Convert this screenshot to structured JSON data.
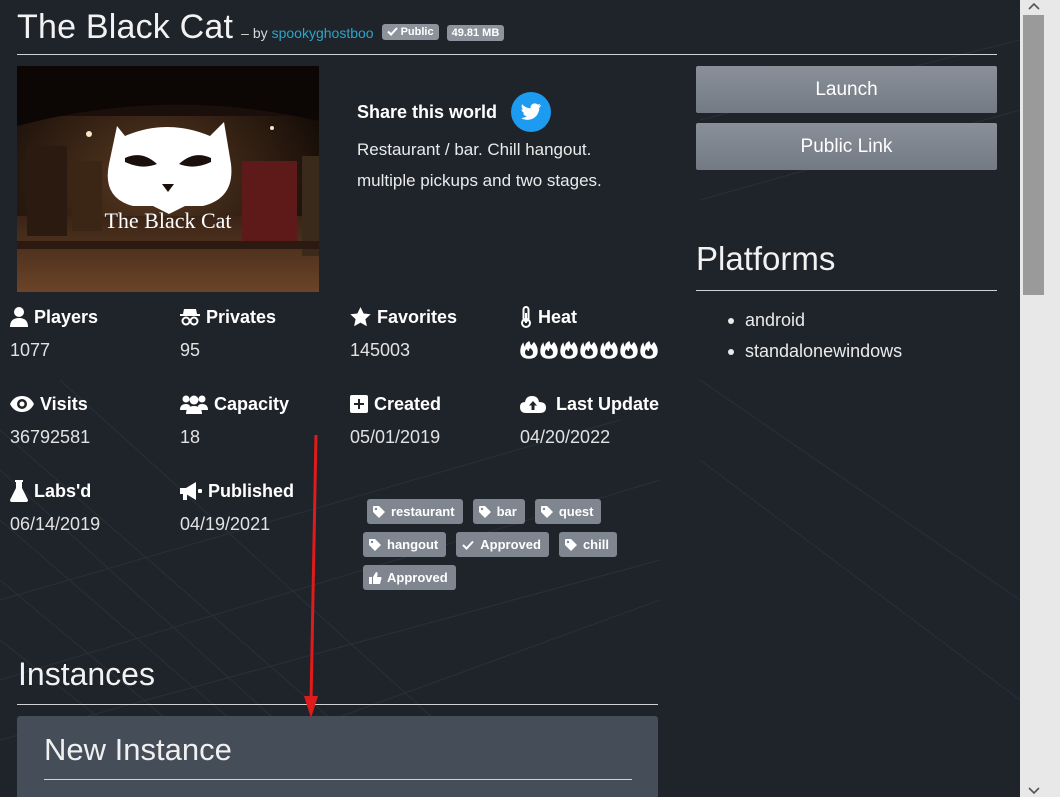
{
  "header": {
    "title": "The Black Cat",
    "by_label": "– by",
    "author": "spookyghostboo",
    "visibility_badge": "Public",
    "size_badge": "49.81 MB"
  },
  "world_image": {
    "overlay_text": "The Black Cat"
  },
  "share": {
    "label": "Share this world",
    "icon": "twitter-icon"
  },
  "description": {
    "line1": "Restaurant / bar. Chill hangout.",
    "line2": "multiple pickups and two stages."
  },
  "actions": {
    "launch": "Launch",
    "public_link": "Public Link"
  },
  "platforms": {
    "title": "Platforms",
    "items": [
      "android",
      "standalonewindows"
    ]
  },
  "stats": {
    "players": {
      "label": "Players",
      "value": "1077",
      "icon": "user-icon"
    },
    "privates": {
      "label": "Privates",
      "value": "95",
      "icon": "incognito-icon"
    },
    "favorites": {
      "label": "Favorites",
      "value": "145003",
      "icon": "star-icon"
    },
    "heat": {
      "label": "Heat",
      "level": 7,
      "max": 7,
      "icon": "thermometer-icon"
    },
    "visits": {
      "label": "Visits",
      "value": "36792581",
      "icon": "eye-icon"
    },
    "capacity": {
      "label": "Capacity",
      "value": "18",
      "icon": "users-icon"
    },
    "created": {
      "label": "Created",
      "value": "05/01/2019",
      "icon": "plus-square-icon"
    },
    "last_update": {
      "label": "Last Update",
      "value": "04/20/2022",
      "icon": "cloud-upload-icon"
    },
    "labs": {
      "label": "Labs'd",
      "value": "06/14/2019",
      "icon": "flask-icon"
    },
    "published": {
      "label": "Published",
      "value": "04/19/2021",
      "icon": "megaphone-icon"
    }
  },
  "tags": [
    {
      "label": "restaurant",
      "icon": "tag-icon"
    },
    {
      "label": "bar",
      "icon": "tag-icon"
    },
    {
      "label": "quest",
      "icon": "tag-icon"
    },
    {
      "label": "hangout",
      "icon": "tag-icon"
    },
    {
      "label": "Approved",
      "icon": "check-icon"
    },
    {
      "label": "chill",
      "icon": "tag-icon"
    },
    {
      "label": "Approved",
      "icon": "thumbs-up-icon"
    }
  ],
  "instances": {
    "title": "Instances",
    "new_instance_title": "New Instance"
  },
  "colors": {
    "background": "#1f232a",
    "accent_link": "#2fa4c7",
    "button": "#7f868f",
    "twitter": "#1d9bf0",
    "annotation_arrow": "#e01b1b"
  }
}
